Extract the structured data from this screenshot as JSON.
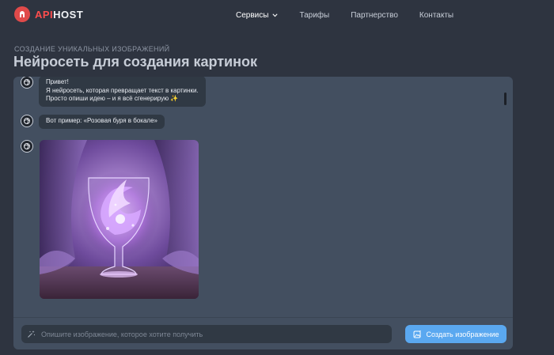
{
  "header": {
    "logo_red": "API",
    "logo_white": "HOST",
    "nav": [
      {
        "label": "Сервисы",
        "icon": "chevron-down-icon"
      },
      {
        "label": "Тарифы"
      },
      {
        "label": "Партнерство"
      },
      {
        "label": "Контакты"
      }
    ]
  },
  "page": {
    "subtitle": "СОЗДАНИЕ УНИКАЛЬНЫХ ИЗОБРАЖЕНИЙ",
    "title": "Нейросеть для создания картинок"
  },
  "chat": {
    "messages": [
      {
        "lines": [
          "Привет!",
          "Я нейросеть, которая превращает текст в картинки.",
          "Просто опиши идею – и я всё сгенерирую"
        ],
        "emoji": "✨"
      },
      {
        "text": "Вот пример: «Розовая буря в бокале»"
      }
    ],
    "image_subject": "purple-storm-in-wine-glass"
  },
  "composer": {
    "placeholder": "Опишите изображение, которое хотите получить",
    "value": "",
    "submit_label": "Создать изображение"
  },
  "colors": {
    "background": "#2e3440",
    "panel": "#434f60",
    "bubble": "#303944",
    "accent": "#5aa8f0",
    "brand_red": "#e04a4a"
  }
}
